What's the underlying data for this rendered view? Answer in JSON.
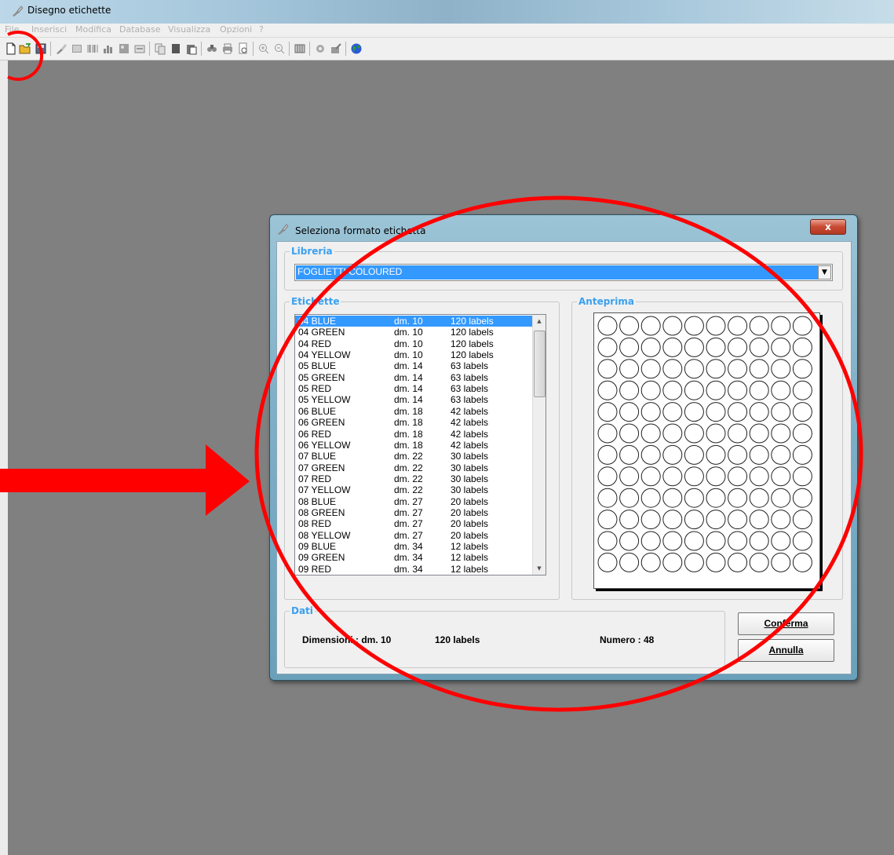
{
  "app": {
    "title": "Disegno etichette",
    "menu": [
      "File",
      "Inserisci",
      "Modifica",
      "Database",
      "Visualizza",
      "Opzioni",
      "?"
    ]
  },
  "dialog": {
    "title": "Seleziona formato etichetta",
    "close_label": "x",
    "libreria": {
      "legend": "Libreria",
      "selected": "FOGLIETTI COLOURED"
    },
    "etichette": {
      "legend": "Etichette",
      "rows": [
        {
          "name": "04 BLUE",
          "dim": "dm. 10",
          "labels": "120 labels",
          "selected": true
        },
        {
          "name": "04 GREEN",
          "dim": "dm. 10",
          "labels": "120 labels"
        },
        {
          "name": "04 RED",
          "dim": "dm. 10",
          "labels": "120 labels"
        },
        {
          "name": "04 YELLOW",
          "dim": "dm. 10",
          "labels": "120 labels"
        },
        {
          "name": "05 BLUE",
          "dim": "dm. 14",
          "labels": "63 labels"
        },
        {
          "name": "05 GREEN",
          "dim": "dm. 14",
          "labels": "63 labels"
        },
        {
          "name": "05 RED",
          "dim": "dm. 14",
          "labels": "63 labels"
        },
        {
          "name": "05 YELLOW",
          "dim": "dm. 14",
          "labels": "63 labels"
        },
        {
          "name": "06 BLUE",
          "dim": "dm. 18",
          "labels": "42 labels"
        },
        {
          "name": "06 GREEN",
          "dim": "dm. 18",
          "labels": "42 labels"
        },
        {
          "name": "06 RED",
          "dim": "dm. 18",
          "labels": "42 labels"
        },
        {
          "name": "06 YELLOW",
          "dim": "dm. 18",
          "labels": "42 labels"
        },
        {
          "name": "07 BLUE",
          "dim": "dm. 22",
          "labels": "30 labels"
        },
        {
          "name": "07 GREEN",
          "dim": "dm. 22",
          "labels": "30 labels"
        },
        {
          "name": "07 RED",
          "dim": "dm. 22",
          "labels": "30 labels"
        },
        {
          "name": "07 YELLOW",
          "dim": "dm. 22",
          "labels": "30 labels"
        },
        {
          "name": "08 BLUE",
          "dim": "dm. 27",
          "labels": "20 labels"
        },
        {
          "name": "08 GREEN",
          "dim": "dm. 27",
          "labels": "20 labels"
        },
        {
          "name": "08 RED",
          "dim": "dm. 27",
          "labels": "20 labels"
        },
        {
          "name": "08 YELLOW",
          "dim": "dm. 27",
          "labels": "20 labels"
        },
        {
          "name": "09 BLUE",
          "dim": "dm. 34",
          "labels": "12 labels"
        },
        {
          "name": "09 GREEN",
          "dim": "dm. 34",
          "labels": "12 labels"
        },
        {
          "name": "09 RED",
          "dim": "dm. 34",
          "labels": "12 labels"
        }
      ]
    },
    "anteprima": {
      "legend": "Anteprima",
      "columns": 10,
      "rows": 12
    },
    "dati": {
      "legend": "Dati",
      "dimensioni": "Dimensioni : dm. 10",
      "labels": "120 labels",
      "numero": "Numero : 48"
    },
    "buttons": {
      "confirm": "Conferma",
      "cancel": "Annulla"
    }
  },
  "annotation_color": "#ff0000"
}
